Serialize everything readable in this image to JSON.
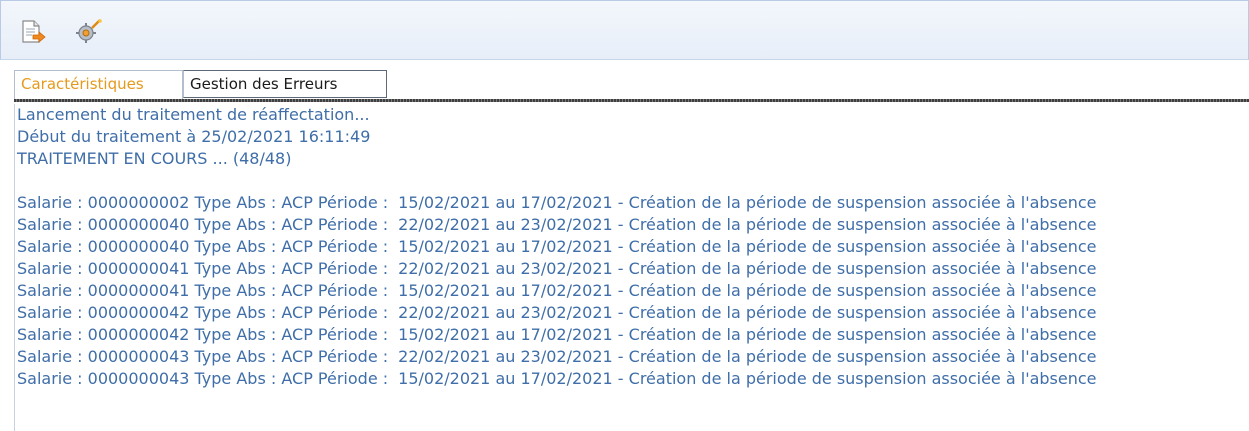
{
  "toolbar": {
    "buttons": [
      {
        "icon": "export-document-icon"
      },
      {
        "icon": "settings-wand-icon"
      }
    ]
  },
  "tabs": [
    {
      "label": "Caractéristiques",
      "active": true
    },
    {
      "label": "Gestion des Erreurs",
      "active": false
    }
  ],
  "log": {
    "header": [
      "Lancement du traitement de réaffectation...",
      "Début du traitement à 25/02/2021 16:11:49",
      "TRAITEMENT EN COURS ... (48/48)"
    ],
    "entries": [
      {
        "prefix": "Salarie : 0000000002 Type Abs : ACP Période :",
        "detail": "15/02/2021 au 17/02/2021 - Création de la période de suspension associée à l'absence"
      },
      {
        "prefix": "Salarie : 0000000040 Type Abs : ACP Période :",
        "detail": "22/02/2021 au 23/02/2021 - Création de la période de suspension associée à l'absence"
      },
      {
        "prefix": "Salarie : 0000000040 Type Abs : ACP Période :",
        "detail": "15/02/2021 au 17/02/2021 - Création de la période de suspension associée à l'absence"
      },
      {
        "prefix": "Salarie : 0000000041 Type Abs : ACP Période :",
        "detail": "22/02/2021 au 23/02/2021 - Création de la période de suspension associée à l'absence"
      },
      {
        "prefix": "Salarie : 0000000041 Type Abs : ACP Période :",
        "detail": "15/02/2021 au 17/02/2021 - Création de la période de suspension associée à l'absence"
      },
      {
        "prefix": "Salarie : 0000000042 Type Abs : ACP Période :",
        "detail": "22/02/2021 au 23/02/2021 - Création de la période de suspension associée à l'absence"
      },
      {
        "prefix": "Salarie : 0000000042 Type Abs : ACP Période :",
        "detail": "15/02/2021 au 17/02/2021 - Création de la période de suspension associée à l'absence"
      },
      {
        "prefix": "Salarie : 0000000043 Type Abs : ACP Période :",
        "detail": "22/02/2021 au 23/02/2021 - Création de la période de suspension associée à l'absence"
      },
      {
        "prefix": "Salarie : 0000000043 Type Abs : ACP Période :",
        "detail": "15/02/2021 au 17/02/2021 - Création de la période de suspension associée à l'absence"
      }
    ]
  },
  "colors": {
    "log_text": "#3f6ea8",
    "active_tab_text": "#e69a1c",
    "toolbar_border": "#b9cbe4"
  }
}
